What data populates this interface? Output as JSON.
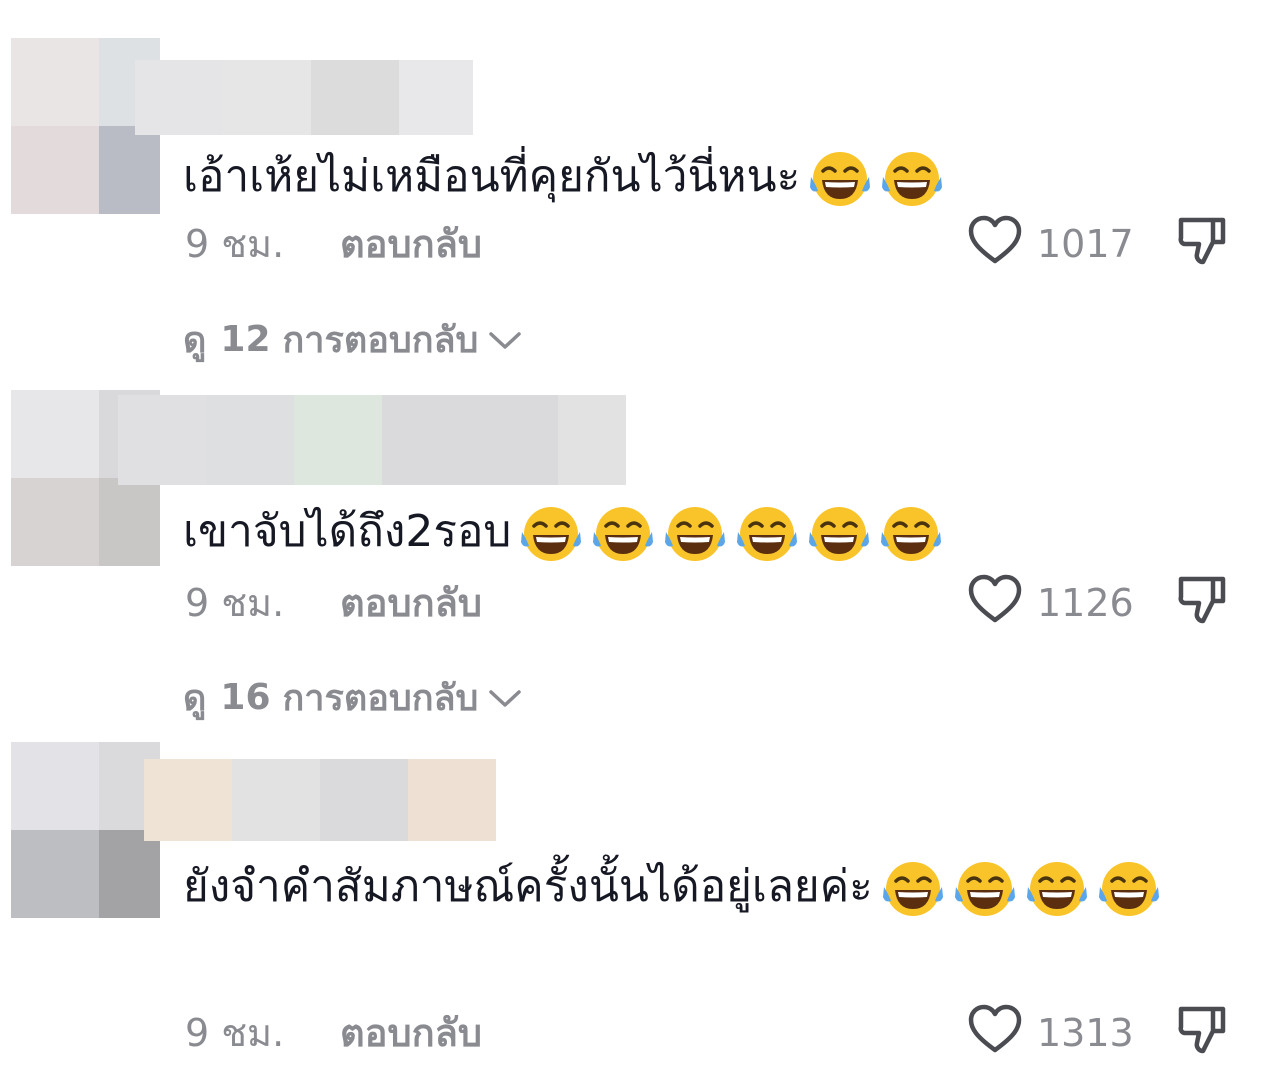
{
  "comments": [
    {
      "avatar_colors": [
        "#e9e5e5",
        "#dde1e4",
        "#e3dbdb",
        "#b9bcc4"
      ],
      "username_colors": [
        "#e5e5e7",
        "#e6e6e6",
        "#dcdcdd",
        "#e8e8ea"
      ],
      "text": "เอ้าเห้ยไม่เหมือนที่คุยกันไว้นี่หนะ",
      "emoji_count": 2,
      "emoji_name": "face-with-tears-of-joy-icon",
      "time": "9 ชม.",
      "reply_label": "ตอบกลับ",
      "likes": "1017",
      "replies": {
        "prefix": "ดู",
        "count": "12",
        "suffix": "การตอบกลับ"
      }
    },
    {
      "avatar_colors": [
        "#e7e7e9",
        "#d9d9db",
        "#d8d3d3",
        "#c9c6c6"
      ],
      "username_colors": [
        "#e0e0e2",
        "#dedfe0",
        "#dde7dd",
        "#dadadc",
        "#e2e2e3"
      ],
      "text": "เขาจับได้ถึง2รอบ",
      "emoji_count": 6,
      "emoji_name": "face-with-tears-of-joy-icon",
      "time": "9 ชม.",
      "reply_label": "ตอบกลับ",
      "likes": "1126",
      "replies": {
        "prefix": "ดู",
        "count": "16",
        "suffix": "การตอบกลับ"
      }
    },
    {
      "avatar_colors": [
        "#e3e3e7",
        "#dadadc",
        "#bcbec2",
        "#a3a3a5"
      ],
      "username_colors": [
        "#efe3d6",
        "#e2e2e3",
        "#dadadc",
        "#eee1d3"
      ],
      "text": "ยังจำคำสัมภาษณ์ครั้งนั้นได้อยู่เลยค่ะ",
      "emoji_count": 4,
      "emoji_name": "face-with-tears-of-joy-icon",
      "time": "9 ชม.",
      "reply_label": "ตอบกลับ",
      "likes": "1313"
    }
  ],
  "colors": {
    "text": "#161823",
    "secondary": "#8a8b91",
    "emoji_face": "#f9c429",
    "emoji_tear": "#5aa6e8"
  }
}
